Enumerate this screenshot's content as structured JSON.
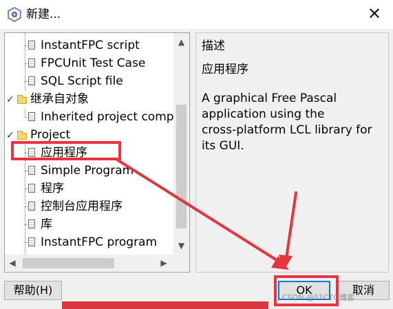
{
  "window": {
    "title": "新建...",
    "close_glyph": "✕"
  },
  "tree": {
    "items": [
      {
        "label": "InstantFPC script",
        "type": "leaf"
      },
      {
        "label": "FPCUnit Test Case",
        "type": "leaf"
      },
      {
        "label": "SQL Script file",
        "type": "leaf"
      },
      {
        "label": "继承自对象",
        "type": "folder"
      },
      {
        "label": "Inherited project comp",
        "type": "leaf"
      },
      {
        "label": "Project",
        "type": "folder"
      },
      {
        "label": "应用程序",
        "type": "leaf",
        "selected": true
      },
      {
        "label": "Simple Program",
        "type": "leaf"
      },
      {
        "label": "程序",
        "type": "leaf"
      },
      {
        "label": "控制台应用程序",
        "type": "leaf"
      },
      {
        "label": "库",
        "type": "leaf"
      },
      {
        "label": "InstantFPC program",
        "type": "leaf"
      }
    ],
    "expand_glyph": "✓"
  },
  "description": {
    "heading": "描述",
    "subtitle": "应用程序",
    "body": "A graphical Free Pascal\napplication using the\ncross-platform LCL library for\nits GUI."
  },
  "buttons": {
    "help": "帮助(H)",
    "ok": "OK",
    "cancel": "取消"
  },
  "scrollbar": {
    "up": "▲",
    "down": "▼",
    "left": "◀",
    "right": "▶"
  },
  "watermark": "CSDN @51CTO博客",
  "annotation_color": "#e8343e",
  "accent_color": "#0078d7"
}
